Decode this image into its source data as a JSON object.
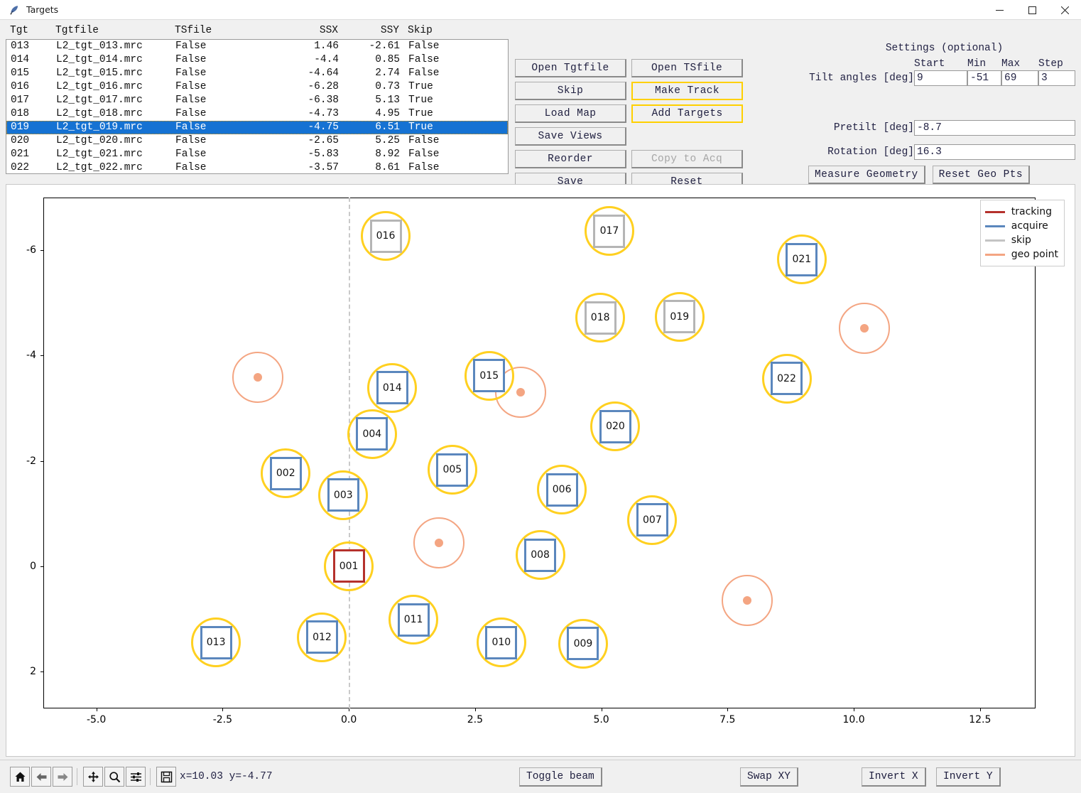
{
  "window": {
    "title": "Targets",
    "icon": "feather-icon",
    "minimize": "─",
    "maximize": "☐",
    "close": "✕"
  },
  "table": {
    "columns": [
      "Tgt",
      "Tgtfile",
      "TSfile",
      "SSX",
      "SSY",
      "Skip"
    ],
    "rows": [
      {
        "tgt": "013",
        "tgtfile": "L2_tgt_013.mrc",
        "tsfile": "False",
        "ssx": "1.46",
        "ssy": "-2.61",
        "skip": "False",
        "selected": false
      },
      {
        "tgt": "014",
        "tgtfile": "L2_tgt_014.mrc",
        "tsfile": "False",
        "ssx": "-4.4",
        "ssy": "0.85",
        "skip": "False",
        "selected": false
      },
      {
        "tgt": "015",
        "tgtfile": "L2_tgt_015.mrc",
        "tsfile": "False",
        "ssx": "-4.64",
        "ssy": "2.74",
        "skip": "False",
        "selected": false
      },
      {
        "tgt": "016",
        "tgtfile": "L2_tgt_016.mrc",
        "tsfile": "False",
        "ssx": "-6.28",
        "ssy": "0.73",
        "skip": "True",
        "selected": false
      },
      {
        "tgt": "017",
        "tgtfile": "L2_tgt_017.mrc",
        "tsfile": "False",
        "ssx": "-6.38",
        "ssy": "5.13",
        "skip": "True",
        "selected": false
      },
      {
        "tgt": "018",
        "tgtfile": "L2_tgt_018.mrc",
        "tsfile": "False",
        "ssx": "-4.73",
        "ssy": "4.95",
        "skip": "True",
        "selected": false
      },
      {
        "tgt": "019",
        "tgtfile": "L2_tgt_019.mrc",
        "tsfile": "False",
        "ssx": "-4.75",
        "ssy": "6.51",
        "skip": "True",
        "selected": true
      },
      {
        "tgt": "020",
        "tgtfile": "L2_tgt_020.mrc",
        "tsfile": "False",
        "ssx": "-2.65",
        "ssy": "5.25",
        "skip": "False",
        "selected": false
      },
      {
        "tgt": "021",
        "tgtfile": "L2_tgt_021.mrc",
        "tsfile": "False",
        "ssx": "-5.83",
        "ssy": "8.92",
        "skip": "False",
        "selected": false
      },
      {
        "tgt": "022",
        "tgtfile": "L2_tgt_022.mrc",
        "tsfile": "False",
        "ssx": "-3.57",
        "ssy": "8.61",
        "skip": "False",
        "selected": false
      }
    ]
  },
  "buttons": {
    "col1": [
      {
        "label": "Open Tgtfile",
        "state": "normal"
      },
      {
        "label": "Skip",
        "state": "normal"
      },
      {
        "label": "Load Map",
        "state": "normal"
      },
      {
        "label": "Save Views",
        "state": "normal"
      },
      {
        "label": "Reorder",
        "state": "normal"
      },
      {
        "label": "Save",
        "state": "normal"
      }
    ],
    "col2": [
      {
        "label": "Open TSfile",
        "state": "normal"
      },
      {
        "label": "Make Track",
        "state": "highlighted"
      },
      {
        "label": "Add Targets",
        "state": "highlighted"
      },
      {
        "label": "",
        "state": "spacer"
      },
      {
        "label": "Copy to Acq",
        "state": "disabled"
      },
      {
        "label": "Reset",
        "state": "normal"
      }
    ]
  },
  "settings": {
    "title": "Settings (optional)",
    "col_headers": [
      "Start",
      "Min",
      "Max",
      "Step"
    ],
    "tilt_label": "Tilt angles [deg]",
    "tilt": {
      "start": "9",
      "min": "-51",
      "max": "69",
      "step": "3"
    },
    "pretilt_label": "Pretilt [deg]",
    "pretilt_value": "-8.7",
    "rotation_label": "Rotation [deg]",
    "rotation_value": "16.3",
    "measure_geometry_label": "Measure Geometry",
    "reset_geo_pts_label": "Reset Geo Pts"
  },
  "chart_data": {
    "type": "scatter",
    "title": "",
    "xlabel": "",
    "ylabel": "",
    "xlim": [
      -6.05,
      13.6
    ],
    "ylim": [
      2.7,
      -7.0
    ],
    "xticks": [
      -5.0,
      -2.5,
      0.0,
      2.5,
      5.0,
      7.5,
      10.0,
      12.5
    ],
    "xticklabels": [
      "-5.0",
      "-2.5",
      "0.0",
      "2.5",
      "5.0",
      "7.5",
      "10.0",
      "12.5"
    ],
    "yticks": [
      -6,
      -4,
      -2,
      0,
      2
    ],
    "yticklabels": [
      "-6",
      "-4",
      "-2",
      "0",
      "2"
    ],
    "grid": false,
    "vertical_dashed_line_x": 0.0,
    "legend": {
      "position": "top-right",
      "entries": [
        {
          "label": "tracking",
          "color": "#b5312c"
        },
        {
          "label": "acquire",
          "color": "#5b87bd"
        },
        {
          "label": "skip",
          "color": "#c4c4c4"
        },
        {
          "label": "geo point",
          "color": "#f4a582"
        }
      ]
    },
    "targets": [
      {
        "label": "001",
        "x": 0.0,
        "y": 0.0,
        "kind": "tracking",
        "ring": "acquire"
      },
      {
        "label": "002",
        "x": -1.25,
        "y": -1.76,
        "kind": "acquire",
        "ring": "acquire"
      },
      {
        "label": "003",
        "x": -0.11,
        "y": -1.35,
        "kind": "acquire",
        "ring": "acquire"
      },
      {
        "label": "004",
        "x": 0.46,
        "y": -2.51,
        "kind": "acquire",
        "ring": "acquire"
      },
      {
        "label": "005",
        "x": 2.05,
        "y": -1.83,
        "kind": "acquire",
        "ring": "acquire"
      },
      {
        "label": "006",
        "x": 4.22,
        "y": -1.45,
        "kind": "acquire",
        "ring": "acquire"
      },
      {
        "label": "007",
        "x": 6.01,
        "y": -0.88,
        "kind": "acquire",
        "ring": "acquire"
      },
      {
        "label": "008",
        "x": 3.79,
        "y": -0.21,
        "kind": "acquire",
        "ring": "acquire"
      },
      {
        "label": "009",
        "x": 4.64,
        "y": 1.47,
        "kind": "acquire",
        "ring": "acquire"
      },
      {
        "label": "010",
        "x": 3.02,
        "y": 1.45,
        "kind": "acquire",
        "ring": "acquire"
      },
      {
        "label": "011",
        "x": 1.28,
        "y": 1.02,
        "kind": "acquire",
        "ring": "acquire"
      },
      {
        "label": "012",
        "x": -0.53,
        "y": 1.35,
        "kind": "acquire",
        "ring": "acquire"
      },
      {
        "label": "013",
        "x": -2.63,
        "y": 1.45,
        "kind": "acquire",
        "ring": "acquire"
      },
      {
        "label": "014",
        "x": 0.86,
        "y": -3.39,
        "kind": "acquire",
        "ring": "acquire"
      },
      {
        "label": "015",
        "x": 2.78,
        "y": -3.62,
        "kind": "acquire",
        "ring": "acquire"
      },
      {
        "label": "016",
        "x": 0.73,
        "y": -6.27,
        "kind": "skip",
        "ring": "acquire"
      },
      {
        "label": "017",
        "x": 5.16,
        "y": -6.36,
        "kind": "skip",
        "ring": "acquire"
      },
      {
        "label": "018",
        "x": 4.98,
        "y": -4.72,
        "kind": "skip",
        "ring": "acquire"
      },
      {
        "label": "019",
        "x": 6.55,
        "y": -4.74,
        "kind": "skip",
        "ring": "acquire"
      },
      {
        "label": "020",
        "x": 5.28,
        "y": -2.65,
        "kind": "acquire",
        "ring": "acquire"
      },
      {
        "label": "021",
        "x": 8.97,
        "y": -5.82,
        "kind": "acquire",
        "ring": "acquire"
      },
      {
        "label": "022",
        "x": 8.67,
        "y": -3.56,
        "kind": "acquire",
        "ring": "acquire"
      }
    ],
    "geo_points": [
      {
        "x": -1.8,
        "y": -3.59
      },
      {
        "x": 3.4,
        "y": -3.3
      },
      {
        "x": 1.79,
        "y": -0.45
      },
      {
        "x": 7.89,
        "y": 0.65
      },
      {
        "x": 10.21,
        "y": -4.52
      }
    ]
  },
  "toolbar": {
    "icons": [
      "home-icon",
      "back-arrow-icon",
      "forward-arrow-icon",
      "pan-icon",
      "zoom-icon",
      "configure-subplots-icon",
      "save-icon"
    ],
    "coords": "x=10.03  y=-4.77",
    "toggle_beam_label": "Toggle beam",
    "swap_xy_label": "Swap XY",
    "invert_x_label": "Invert X",
    "invert_y_label": "Invert Y"
  }
}
